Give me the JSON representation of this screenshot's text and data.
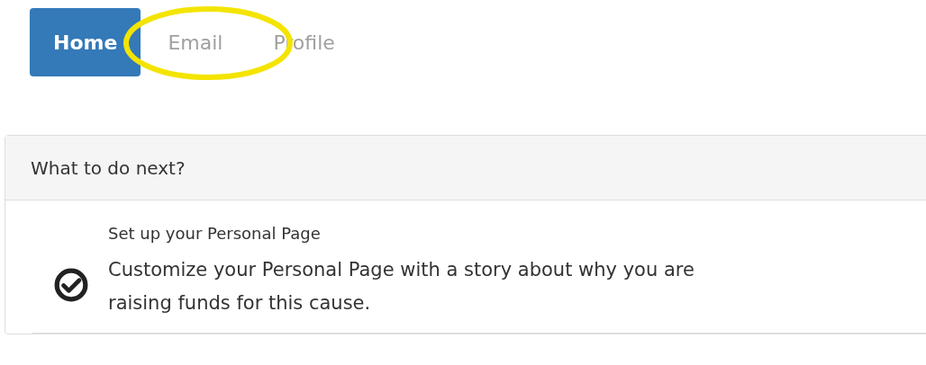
{
  "tabs": [
    {
      "label": "Home",
      "selected": true
    },
    {
      "label": "Email",
      "selected": false
    },
    {
      "label": "Profile",
      "selected": false
    }
  ],
  "panel": {
    "heading": "What to do next?",
    "items": [
      {
        "title": "Set up your Personal Page",
        "description": "Customize your Personal Page with a story about why you are raising funds for this cause.",
        "done": true
      }
    ]
  }
}
